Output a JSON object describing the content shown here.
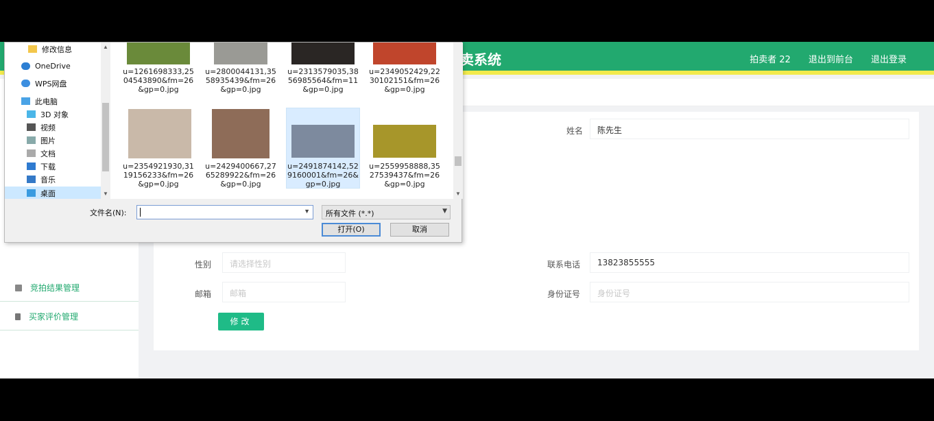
{
  "app": {
    "title": "卖系统",
    "header_links": [
      "拍卖者 22",
      "退出到前台",
      "退出登录"
    ]
  },
  "sidebar": {
    "items": [
      {
        "label": "竞拍结果管理",
        "icon": "list-icon"
      },
      {
        "label": "买家评价管理",
        "icon": "flag-icon"
      }
    ]
  },
  "form": {
    "name_label": "姓名",
    "name_value": "陈先生",
    "gender_label": "性别",
    "gender_placeholder": "请选择性别",
    "phone_label": "联系电话",
    "phone_value": "13823855555",
    "email_label": "邮箱",
    "email_placeholder": "邮箱",
    "id_label": "身份证号",
    "id_placeholder": "身份证号",
    "submit_label": "修改"
  },
  "dialog": {
    "nav_items": [
      {
        "label": "修改信息",
        "icon": "folder-icon"
      },
      {
        "label": "OneDrive",
        "icon": "cloud-icon"
      },
      {
        "label": "WPS网盘",
        "icon": "cloud-icon"
      },
      {
        "label": "此电脑",
        "icon": "computer-icon"
      },
      {
        "label": "3D 对象",
        "icon": "cube-icon"
      },
      {
        "label": "视频",
        "icon": "video-icon"
      },
      {
        "label": "图片",
        "icon": "picture-icon"
      },
      {
        "label": "文档",
        "icon": "document-icon"
      },
      {
        "label": "下载",
        "icon": "download-icon"
      },
      {
        "label": "音乐",
        "icon": "music-icon"
      },
      {
        "label": "桌面",
        "icon": "desktop-icon"
      }
    ],
    "files": [
      {
        "name": "u=1261698333,2504543890&fm=26&gp=0.jpg",
        "color": "#6a8a3a"
      },
      {
        "name": "u=2800044131,3558935439&fm=26&gp=0.jpg",
        "color": "#9a9a95"
      },
      {
        "name": "u=2313579035,3856985564&fm=11&gp=0.jpg",
        "color": "#2a2624"
      },
      {
        "name": "u=2349052429,2230102151&fm=26&gp=0.jpg",
        "color": "#c0452c"
      },
      {
        "name": "u=2354921930,3119156233&fm=26&gp=0.jpg",
        "color": "#c9b9a9"
      },
      {
        "name": "u=2429400667,2765289922&fm=26&gp=0.jpg",
        "color": "#8e6c58"
      },
      {
        "name": "u=2491874142,529160001&fm=26&gp=0.jpg",
        "color": "#7d8a9e"
      },
      {
        "name": "u=2559958888,3527539437&fm=26&gp=0.jpg",
        "color": "#a7962a"
      }
    ],
    "filename_label": "文件名(N):",
    "filename_value": "",
    "filetype_value": "所有文件 (*.*)",
    "open_label": "打开(O)",
    "cancel_label": "取消"
  }
}
